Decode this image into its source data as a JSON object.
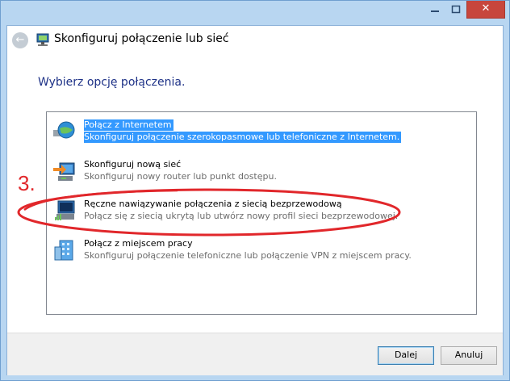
{
  "window": {
    "close_glyph": "✕",
    "back_glyph": "←",
    "title": "Skonfiguruj połączenie lub sieć"
  },
  "instruction": "Wybierz opcję połączenia.",
  "options": [
    {
      "title": "Połącz z Internetem",
      "desc": "Skonfiguruj połączenie szerokopasmowe lub telefoniczne z Internetem.",
      "icon": "internet-globe-icon",
      "selected": true
    },
    {
      "title": "Skonfiguruj nową sieć",
      "desc": "Skonfiguruj nowy router lub punkt dostępu.",
      "icon": "new-network-router-icon",
      "selected": false
    },
    {
      "title": "Ręczne nawiązywanie połączenia z siecią bezprzewodową",
      "desc": "Połącz się z siecią ukrytą lub utwórz nowy profil sieci bezprzewodowej.",
      "icon": "wireless-network-icon",
      "selected": false
    },
    {
      "title": "Połącz z miejscem pracy",
      "desc": "Skonfiguruj połączenie telefoniczne lub połączenie VPN z miejscem pracy.",
      "icon": "workplace-building-icon",
      "selected": false
    }
  ],
  "buttons": {
    "next": "Dalej",
    "cancel": "Anuluj"
  },
  "annotation": {
    "step": "3.",
    "color": "#e1272b"
  },
  "colors": {
    "selection": "#3399ff",
    "instruction": "#1e3287",
    "frame": "#b8d6f1"
  }
}
